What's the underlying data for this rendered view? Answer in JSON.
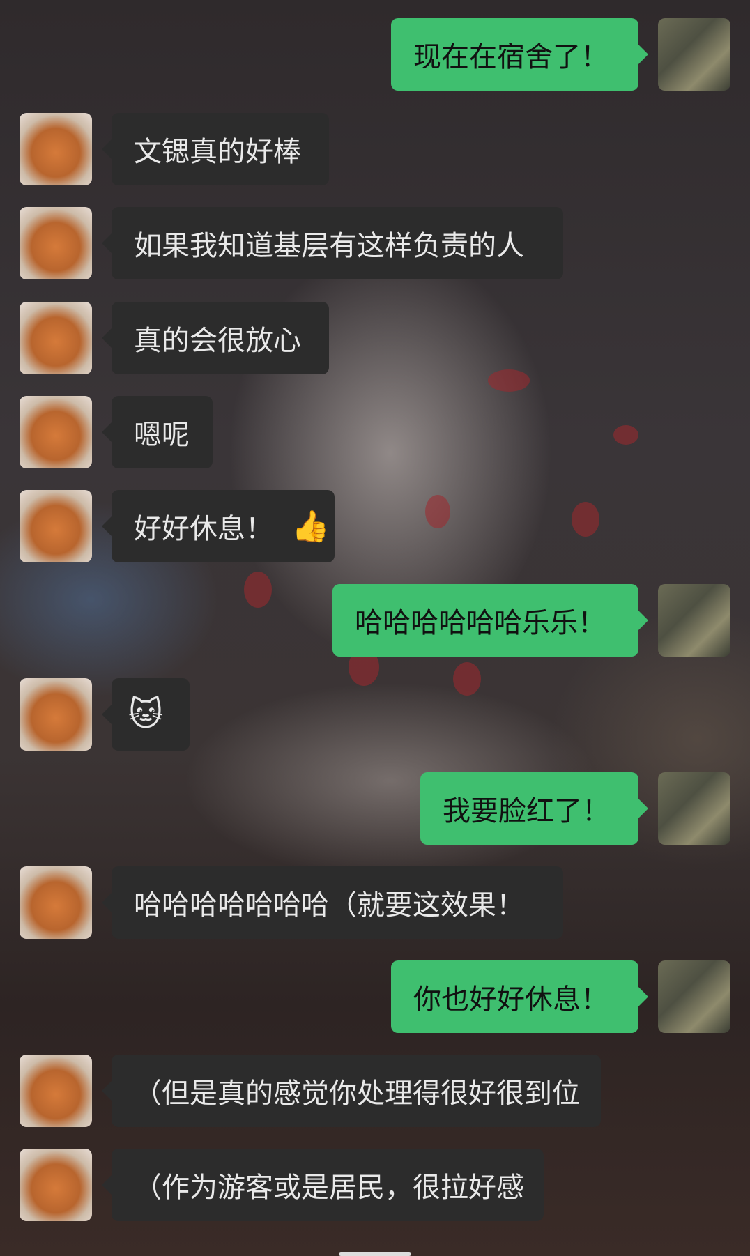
{
  "messages": [
    {
      "dir": "out",
      "text": "现在在宿舍了！"
    },
    {
      "dir": "in",
      "text": "文锶真的好棒"
    },
    {
      "dir": "in",
      "text": "如果我知道基层有这样负责的人"
    },
    {
      "dir": "in",
      "text": "真的会很放心"
    },
    {
      "dir": "in",
      "text": "嗯呢"
    },
    {
      "dir": "in",
      "text": "好好休息！",
      "emoji": "👍"
    },
    {
      "dir": "out",
      "text": "哈哈哈哈哈哈乐乐！"
    },
    {
      "dir": "in",
      "text": "",
      "emoji": "🐱"
    },
    {
      "dir": "out",
      "text": "我要脸红了！"
    },
    {
      "dir": "in",
      "text": "哈哈哈哈哈哈哈（就要这效果！"
    },
    {
      "dir": "out",
      "text": "你也好好休息！"
    },
    {
      "dir": "in",
      "text": "（但是真的感觉你处理得很好很到位"
    },
    {
      "dir": "in",
      "text": "（作为游客或是居民，很拉好感"
    }
  ],
  "colors": {
    "outgoing_bubble": "#3fbf6f",
    "incoming_bubble": "#2c2c2c"
  },
  "icons": {
    "contact_avatar": "shiba-dog-avatar",
    "self_avatar": "person-in-library-avatar"
  }
}
